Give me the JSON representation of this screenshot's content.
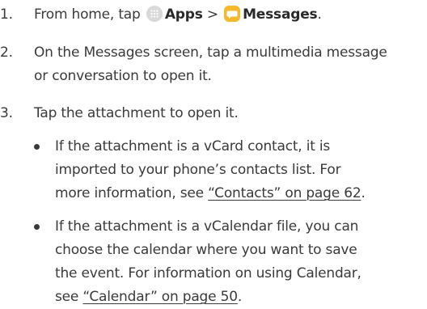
{
  "steps": [
    {
      "number": "1.",
      "pre": "From home, tap ",
      "apps_label": "Apps",
      "separator": " > ",
      "messages_label": "Messages",
      "post": "."
    },
    {
      "number": "2.",
      "line1": "On the Messages screen, tap a multimedia message",
      "line2": "or conversation to open it."
    },
    {
      "number": "3.",
      "line1": "Tap the attachment to open it."
    }
  ],
  "bullets": [
    {
      "line1": "If the attachment is a vCard contact, it is",
      "line2": "imported to your phone’s contacts list. For",
      "line3_pre": "more information, see ",
      "line3_link": "“Contacts” on page 62",
      "line3_post": "."
    },
    {
      "line1": "If the attachment is a vCalendar file, you can",
      "line2": "choose the calendar where you want to save",
      "line3": "the event. For information on using Calendar,",
      "line4_pre": "see ",
      "line4_link": "“Calendar” on page 50",
      "line4_post": "."
    }
  ],
  "icons": {
    "apps": "apps-grid-icon",
    "messages": "messages-icon",
    "messages_color": "#f5b82e"
  }
}
